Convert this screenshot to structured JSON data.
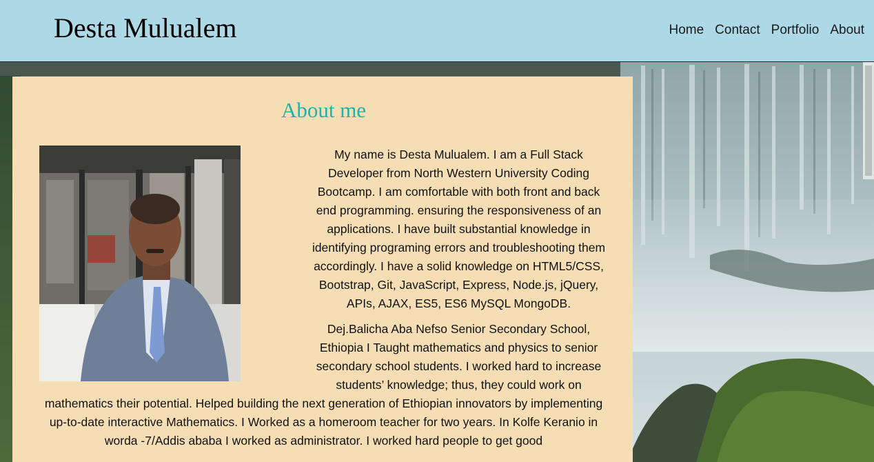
{
  "header": {
    "site_title": "Desta Mulualem",
    "nav": [
      {
        "label": "Home"
      },
      {
        "label": "Contact"
      },
      {
        "label": "Portfolio"
      },
      {
        "label": "About"
      }
    ]
  },
  "about": {
    "heading": "About me",
    "paragraphs": [
      "My name is Desta Mulualem. I am a Full Stack Developer from North Western University Coding Bootcamp. I am comfortable with both front and back end programming. ensuring the responsiveness of an applications. I have built substantial knowledge in identifying programing errors and troubleshooting them accordingly. I have a solid knowledge on HTML5/CSS, Bootstrap, Git, JavaScript, Express, Node.js, jQuery, APIs, AJAX, ES5, ES6 MySQL MongoDB.",
      "Dej.Balicha Aba Nefso Senior Secondary School, Ethiopia I Taught mathematics and physics to senior secondary school students. I worked hard to increase students’ knowledge; thus, they could work on mathematics their potential. Helped building the next generation of Ethiopian innovators by implementing up-to-date interactive Mathematics. I Worked as a homeroom teacher for two years. In Kolfe Keranio in worda -7/Addis ababa I worked as administrator. I worked hard people to get good"
    ]
  },
  "colors": {
    "header_bg": "#add8e6",
    "panel_bg": "#f5deb3",
    "heading_color": "#20b2aa"
  }
}
